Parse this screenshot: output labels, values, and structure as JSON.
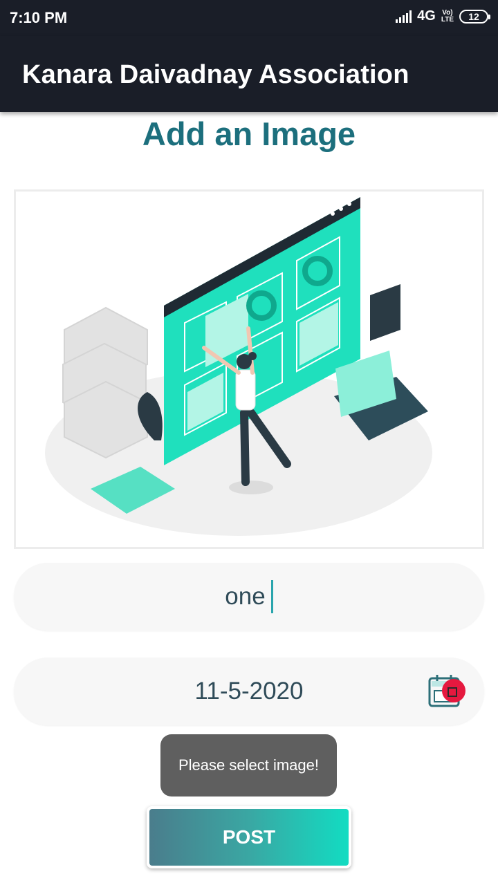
{
  "status": {
    "time": "7:10 PM",
    "network": "4G",
    "volte_top": "Vo)",
    "volte_bottom": "LTE",
    "battery": "12"
  },
  "appbar": {
    "title": "Kanara Daivadnay Association"
  },
  "page": {
    "heading": "Add an Image"
  },
  "form": {
    "title_value": "one",
    "date_value": "11-5-2020",
    "date_icon": "calendar-icon"
  },
  "toast": {
    "message": "Please select image!"
  },
  "actions": {
    "post_label": "POST"
  },
  "colors": {
    "accent": "#1c6f7d",
    "illustration_teal": "#1fe0bd",
    "appbar": "#1a1e28",
    "badge": "#e5193f"
  }
}
